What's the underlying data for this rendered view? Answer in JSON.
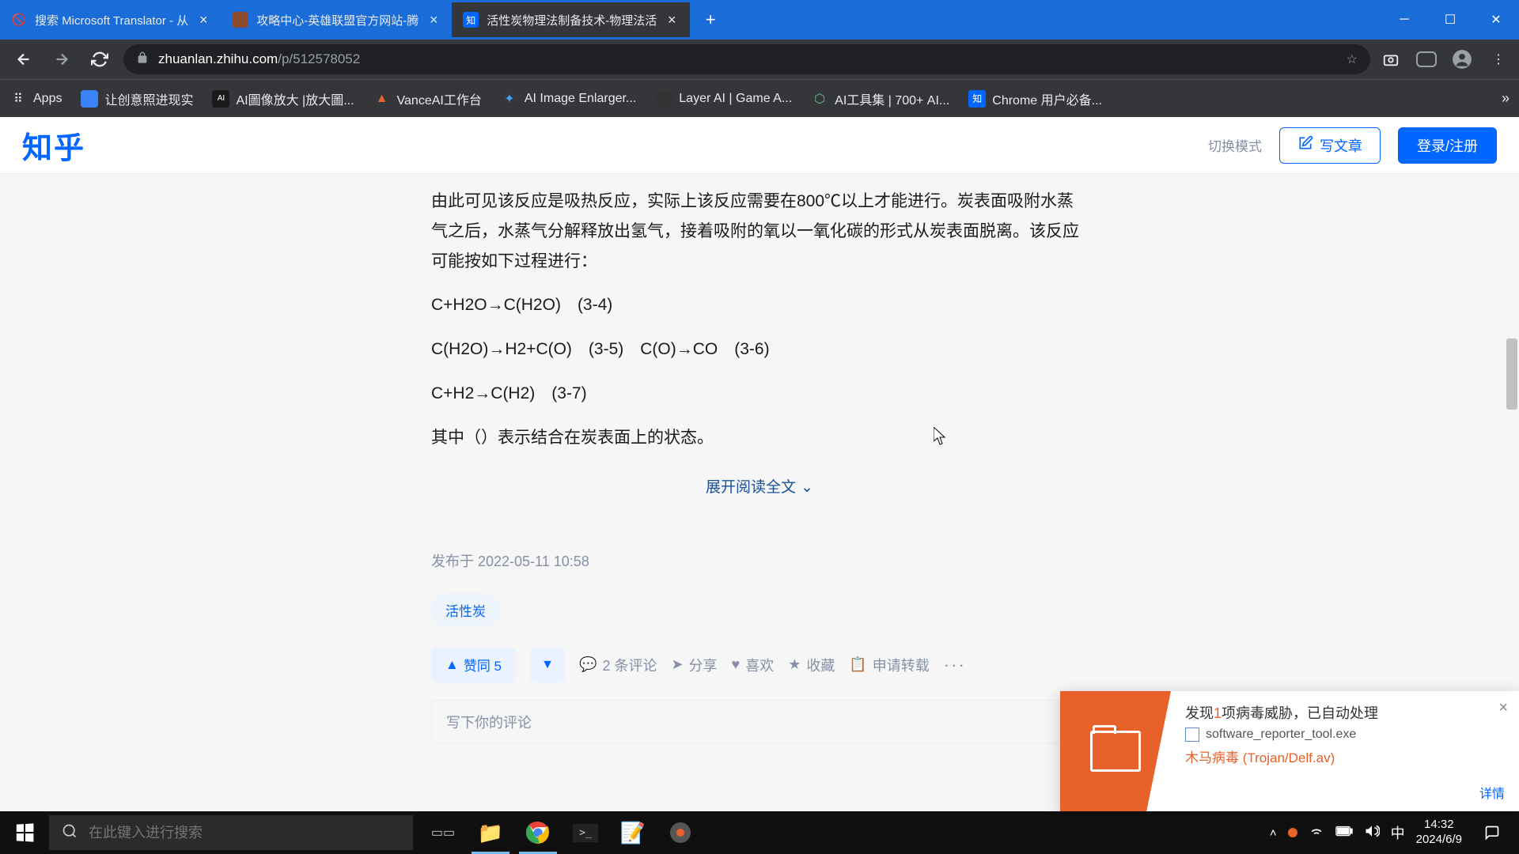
{
  "tabs": [
    {
      "title": "搜索 Microsoft Translator - 从"
    },
    {
      "title": "攻略中心-英雄联盟官方网站-腾"
    },
    {
      "title": "活性炭物理法制备技术-物理法活"
    }
  ],
  "url": {
    "domain": "zhuanlan.zhihu.com",
    "path": "/p/512578052"
  },
  "bookmarks": [
    {
      "icon": "⠿",
      "label": "Apps"
    },
    {
      "icon": "",
      "label": "让创意照进现实"
    },
    {
      "icon": "AI",
      "label": "AI圖像放大 |放大圖..."
    },
    {
      "icon": "",
      "label": "VanceAI工作台"
    },
    {
      "icon": "",
      "label": "AI Image Enlarger..."
    },
    {
      "icon": "",
      "label": "Layer AI | Game A..."
    },
    {
      "icon": "",
      "label": "AI工具集 | 700+ AI..."
    },
    {
      "icon": "知",
      "label": "Chrome 用户必备..."
    }
  ],
  "zhihu": {
    "logo": "知乎",
    "mode_toggle": "切换模式",
    "write": "写文章",
    "login": "登录/注册"
  },
  "article": {
    "p1": "由此可见该反应是吸热反应，实际上该反应需要在800℃以上才能进行。炭表面吸附水蒸气之后，水蒸气分解释放出氢气，接着吸附的氧以一氧化碳的形式从炭表面脱离。该反应可能按如下过程进行：",
    "eq1": "C+H2O→C(H2O)　(3-4)",
    "eq2": "C(H2O)→H2+C(O)　(3-5)　C(O)→CO　(3-6)",
    "eq3": "C+H2→C(H2)　(3-7)",
    "p2": "其中（）表示结合在炭表面上的状态。",
    "expand": "展开阅读全文",
    "pub": "发布于 2022-05-11 10:58",
    "tag": "活性炭",
    "vote": "赞同 5",
    "comments": "2 条评论",
    "share": "分享",
    "like": "喜欢",
    "favorite": "收藏",
    "repost": "申请转载",
    "comment_ph": "写下你的评论"
  },
  "av": {
    "title_pre": "发现",
    "title_count": "1",
    "title_post": "项病毒威胁，已自动处理",
    "file": "software_reporter_tool.exe",
    "threat": "木马病毒 (Trojan/Delf.av)",
    "detail": "详情"
  },
  "taskbar": {
    "search_ph": "在此键入进行搜索",
    "ime": "中",
    "time": "14:32",
    "date": "2024/6/9"
  }
}
